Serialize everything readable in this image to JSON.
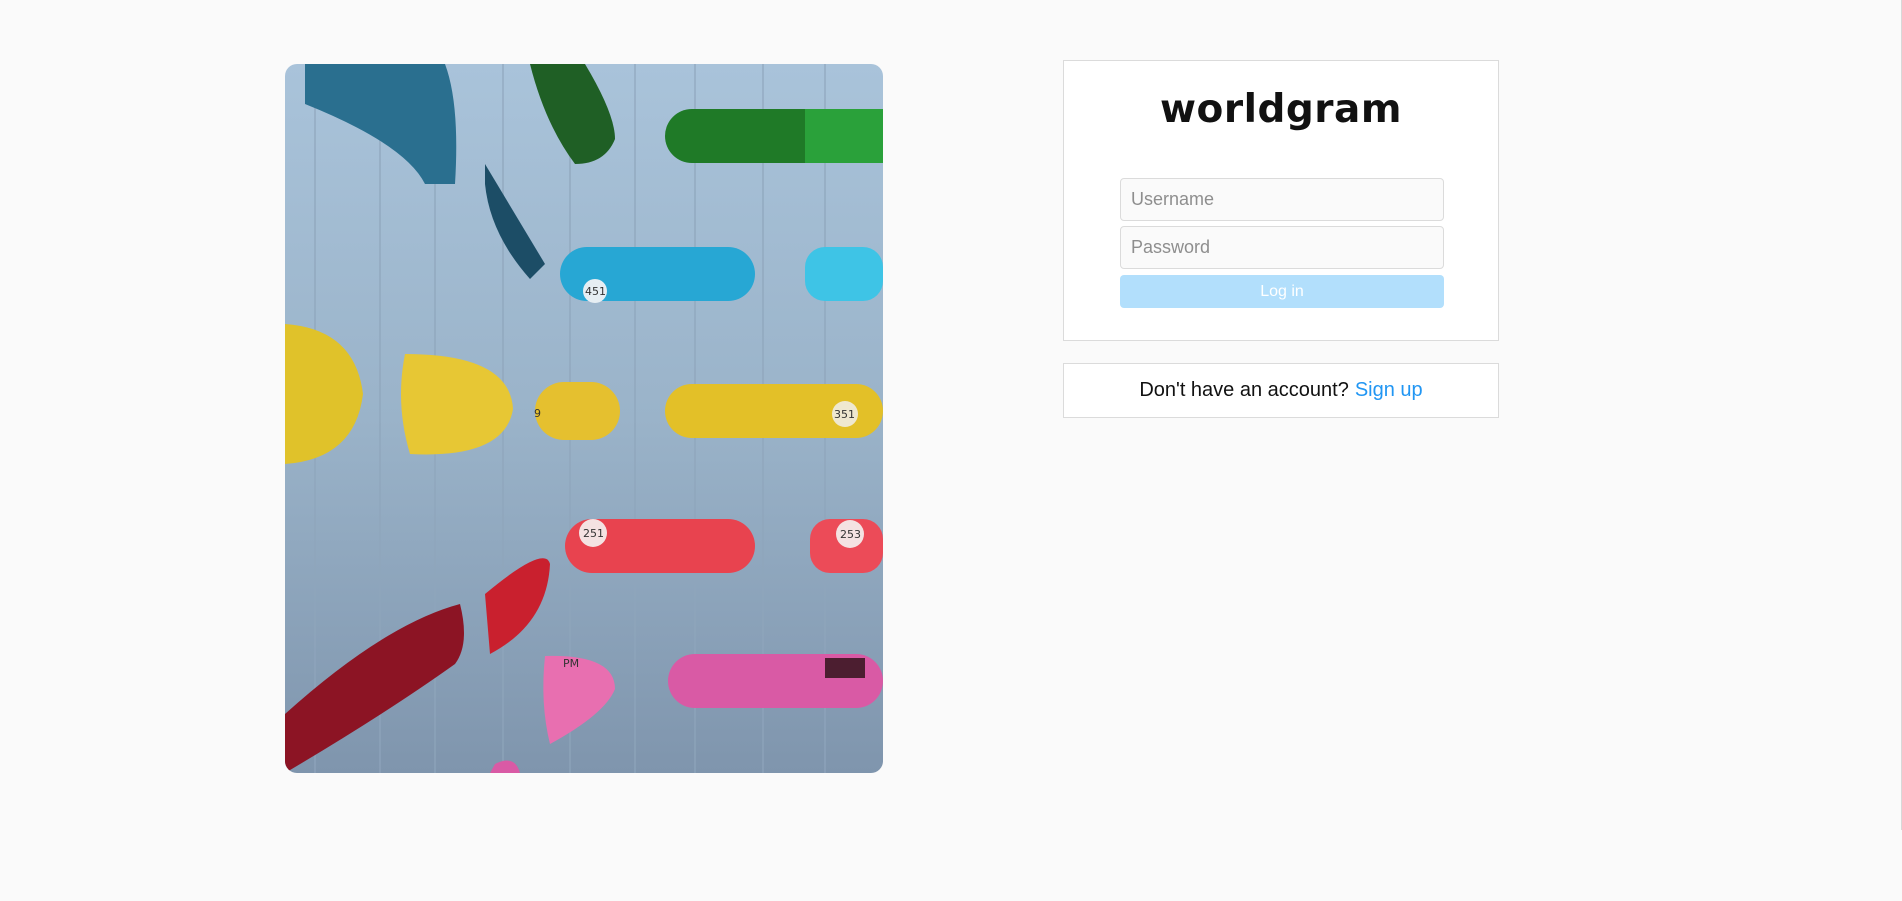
{
  "brand": {
    "name": "worldgram"
  },
  "login": {
    "username_placeholder": "Username",
    "username_value": "",
    "password_placeholder": "Password",
    "password_value": "",
    "button_label": "Log in"
  },
  "signup": {
    "prompt": "Don't have an account?",
    "link_label": "Sign up"
  },
  "hero": {
    "alt": "Colorful architectural openings in a concrete wall",
    "room_numbers": [
      "451",
      "351",
      "251",
      "253",
      "9",
      "PM"
    ]
  },
  "colors": {
    "page_background": "#fafafa",
    "card_border": "#dbdbdb",
    "button_disabled": "#b2dffc",
    "link": "#2196f3"
  }
}
